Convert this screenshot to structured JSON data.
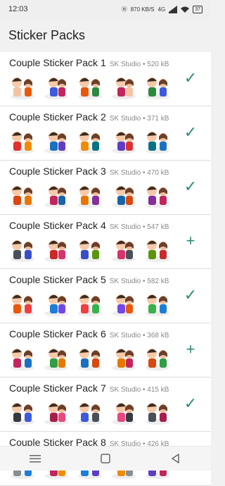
{
  "status": {
    "time": "12:03",
    "network_speed": "870 KB/S",
    "network_label": "4G",
    "battery": "37",
    "icons": [
      "nfc-icon",
      "speed-icon",
      "signal-icon",
      "signal-icon",
      "wifi-icon",
      "battery-icon"
    ]
  },
  "app": {
    "title": "Sticker Packs"
  },
  "packs": [
    {
      "name": "Couple Sticker Pack 1",
      "meta": "SK Studio • 520 kB",
      "action": "added"
    },
    {
      "name": "Couple Sticker Pack 2",
      "meta": "SK Studio • 371 kB",
      "action": "added"
    },
    {
      "name": "Couple Sticker Pack 3",
      "meta": "SK Studio • 470 kB",
      "action": "added"
    },
    {
      "name": "Couple Sticker Pack 4",
      "meta": "SK Studio • 547 kB",
      "action": "add"
    },
    {
      "name": "Couple Sticker Pack 5",
      "meta": "SK Studio • 582 kB",
      "action": "added"
    },
    {
      "name": "Couple Sticker Pack 6",
      "meta": "SK Studio • 368 kB",
      "action": "add"
    },
    {
      "name": "Couple Sticker Pack 7",
      "meta": "SK Studio • 415 kB",
      "action": "added"
    },
    {
      "name": "Couple Sticker Pack 8",
      "meta": "SK Studio • 426 kB",
      "action": "added"
    }
  ],
  "action_symbols": {
    "added": "✓",
    "add": "+"
  },
  "colors": {
    "accent": "#2e8b78",
    "background": "#f1f1f1",
    "card": "#ffffff"
  },
  "navigation": {
    "menu_icon": "menu-icon",
    "home_icon": "home-square-icon",
    "back_icon": "back-triangle-icon"
  }
}
